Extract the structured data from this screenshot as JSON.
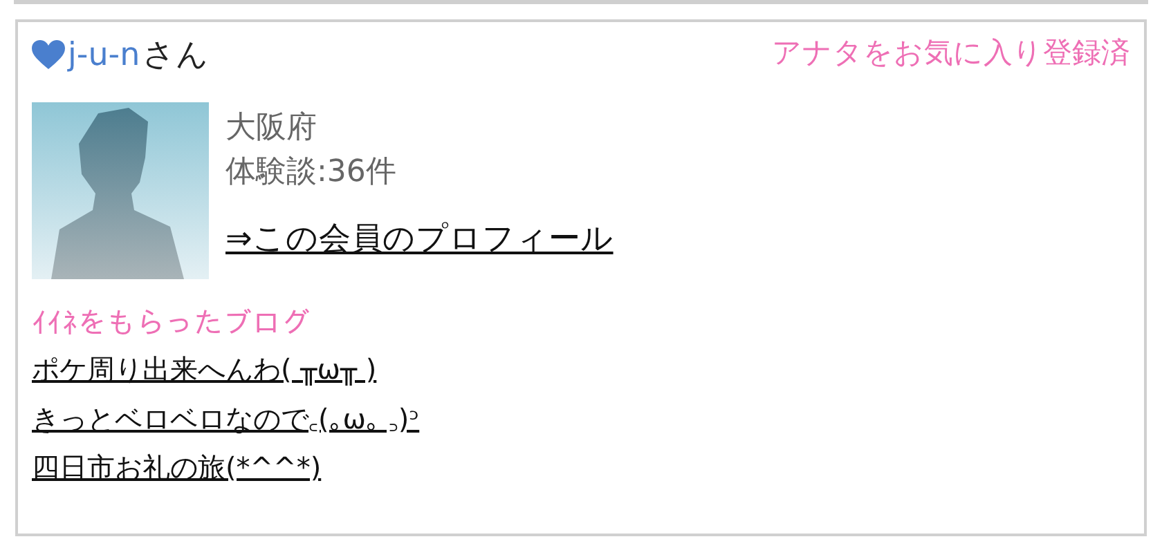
{
  "member": {
    "heart": true,
    "name": "j-u-n",
    "suffix": "さん",
    "favorite_status": "アナタをお気に入り登録済",
    "region": "大阪府",
    "reviews": "体験談:36件",
    "profile_link": "⇒この会員のプロフィール"
  },
  "liked_blogs": {
    "heading": "ｲｲﾈをもらったブログ",
    "items": [
      {
        "title": "ポケ周り出来へんわ( ╥ω╥ )"
      },
      {
        "title": "きっとベロベロなので꜀(｡ω｡ ꜆)ᵓ"
      },
      {
        "title": "四日市お礼の旅(*^^*)"
      }
    ]
  }
}
